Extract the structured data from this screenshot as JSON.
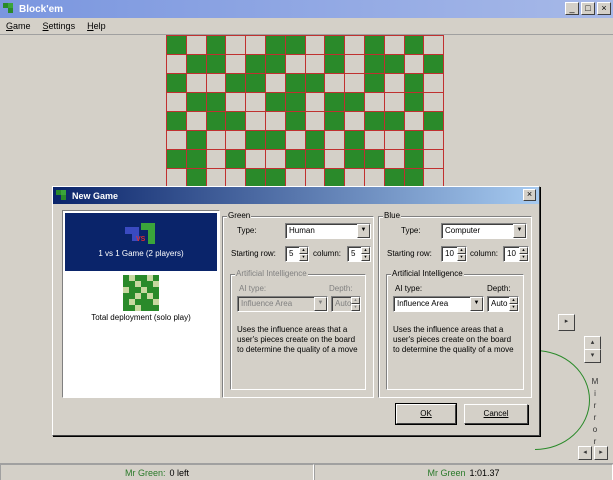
{
  "window": {
    "title": "Block'em",
    "min": "_",
    "max": "□",
    "close": "×"
  },
  "menu": [
    "Game",
    "Settings",
    "Help"
  ],
  "board": {
    "rows": [
      "GEGEEGGEGEGEGE",
      "EGGEGGEEGEGGEG",
      "GEEGGEGGEEGEGE",
      "EGGEEGGEGGEEGE",
      "GEGGEEGEGEGGEG",
      "EGEEGGEGEGEEGE",
      "GGEGEEGGEGGEGE",
      "EGEEGGEEGEEGGE"
    ],
    "colors": {
      "green": "#2a8a2a",
      "empty": "#d4d0c8",
      "grid": "#c03030"
    }
  },
  "side": {
    "mirror_label": "Mirror",
    "right": "▸",
    "up": "▴",
    "down": "▾",
    "left": "◂"
  },
  "status": {
    "player": "Mr Green:",
    "pieces": "0 left",
    "player2": "Mr Green",
    "time": "1:01.37"
  },
  "dialog": {
    "title": "New Game",
    "close": "×",
    "modes": [
      {
        "label": "1 vs 1 Game (2 players)",
        "selected": true
      },
      {
        "label": "Total deployment (solo play)",
        "selected": false
      }
    ],
    "green": {
      "legend": "Green",
      "type_label": "Type:",
      "type_value": "Human",
      "start_label": "Starting row:",
      "row_value": "5",
      "col_label": "column:",
      "col_value": "5",
      "ai_legend": "Artificial Intelligence",
      "ai_type_label": "AI type:",
      "ai_type_value": "Influence Area",
      "depth_label": "Depth:",
      "depth_value": "Auto",
      "description": "Uses the influence areas that a user's pieces create on the board to determine the quality of a move"
    },
    "blue": {
      "legend": "Blue",
      "type_label": "Type:",
      "type_value": "Computer",
      "start_label": "Starting row:",
      "row_value": "10",
      "col_label": "column:",
      "col_value": "10",
      "ai_legend": "Artificial Intelligence",
      "ai_type_label": "AI type:",
      "ai_type_value": "Influence Area",
      "depth_label": "Depth:",
      "depth_value": "Auto",
      "description": "Uses the influence areas that a user's pieces create on the board to determine the quality of a move"
    },
    "ok": "OK",
    "cancel": "Cancel"
  }
}
